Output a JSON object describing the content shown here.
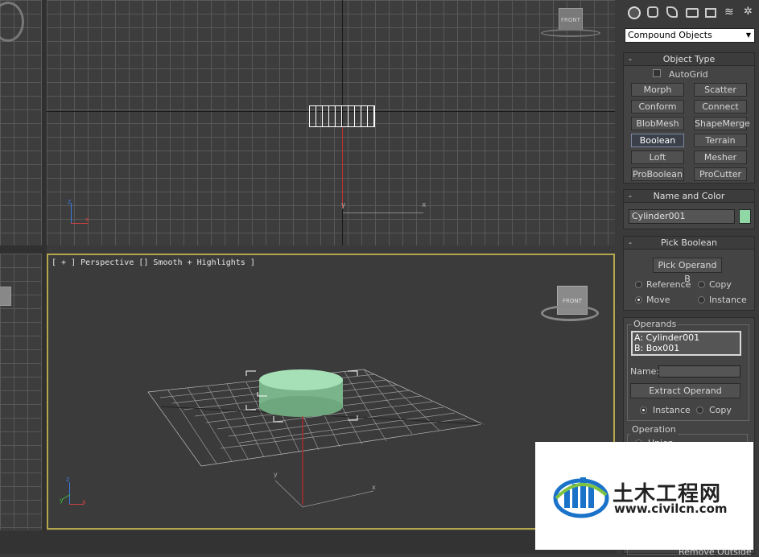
{
  "viewport_perspective": {
    "label": "[ + ] Perspective [] Smooth + Highlights ]",
    "cube_label": "FRONT"
  },
  "viewport_top": {
    "cube_label": "FRONT"
  },
  "command_panel": {
    "category_dropdown": "Compound Objects",
    "tab_icons": [
      "create-geometry-icon",
      "shapes-icon",
      "lights-icon",
      "cameras-icon",
      "helpers-icon",
      "spacewarps-icon",
      "systems-icon"
    ],
    "object_type": {
      "title": "Object Type",
      "autogrid": "AutoGrid",
      "buttons": [
        "Morph",
        "Scatter",
        "Conform",
        "Connect",
        "BlobMesh",
        "ShapeMerge",
        "Boolean",
        "Terrain",
        "Loft",
        "Mesher",
        "ProBoolean",
        "ProCutter"
      ]
    },
    "name_color": {
      "title": "Name and Color",
      "name": "Cylinder001",
      "color": "#8fd8a6"
    },
    "pick_boolean": {
      "title": "Pick Boolean",
      "pick_button": "Pick Operand B",
      "reference": "Reference",
      "copy": "Copy",
      "move": "Move",
      "instance": "Instance"
    },
    "parameters": {
      "operands_label": "Operands",
      "operand_a": "A: Cylinder001",
      "operand_b": "B: Box001",
      "name_label": "Name:",
      "extract_button": "Extract Operand",
      "instance": "Instance",
      "copy": "Copy",
      "operation_label": "Operation",
      "union": "Union",
      "remove_outside": "Remove Outside"
    }
  },
  "watermark": {
    "title": "土木工程网",
    "url": "www.civilcn.com"
  }
}
